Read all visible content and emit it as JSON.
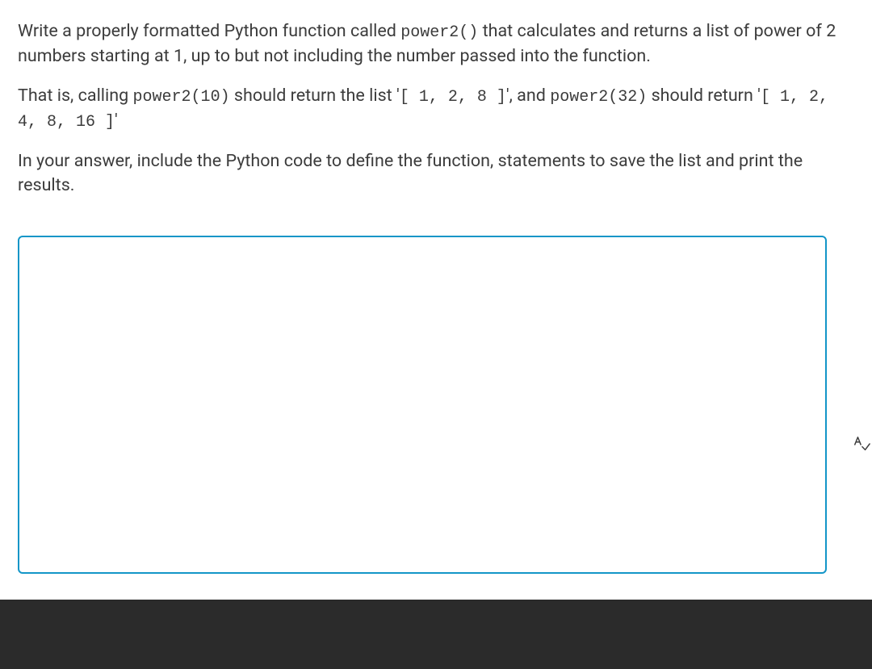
{
  "question": {
    "para1_pre": "Write a properly formatted Python function called ",
    "para1_code1": "power2()",
    "para1_post": " that calculates and returns a list of power of 2 numbers starting at 1, up to but not including the number passed into the function.",
    "para2_pre": "That is, calling ",
    "para2_code1": "power2(10)",
    "para2_mid1": " should return the list '",
    "para2_code2": "[ 1, 2, 8 ]",
    "para2_mid2": "', and ",
    "para2_code3": "power2(32)",
    "para2_mid3": " should return '",
    "para2_code4": "[ 1, 2, 4, 8, 16 ]",
    "para2_post": "'",
    "para3": "In your answer, include the Python code to define the function, statements to save the list and print the results."
  },
  "answer": {
    "value": ""
  },
  "icons": {
    "spellcheck": "spellcheck-icon"
  }
}
